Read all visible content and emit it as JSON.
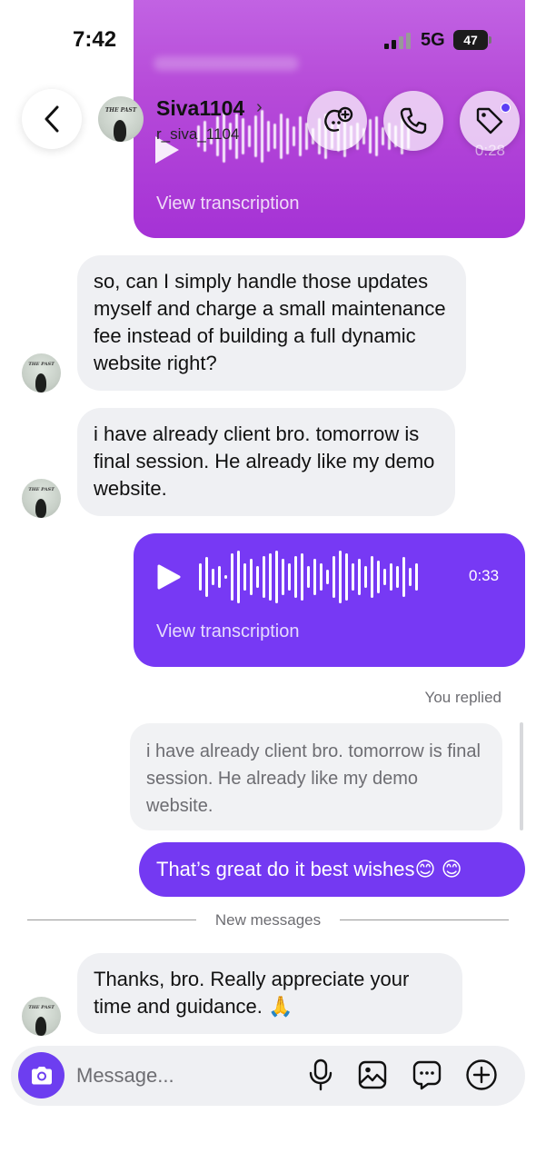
{
  "status_bar": {
    "time": "7:42",
    "network": "5G",
    "battery": "47"
  },
  "header": {
    "contact_name": "Siva1104",
    "contact_handle": "r_siva_1104",
    "name_chevron": "›",
    "avatar_text": "THE PAST"
  },
  "top_voice": {
    "duration": "0:28",
    "transcription_label": "View transcription"
  },
  "messages": {
    "recv_1": "so, can I simply handle those updates myself and charge a small maintenance fee instead of building a full dynamic website right?",
    "recv_2": "i have already client bro. tomorrow is final session. He already like my demo website.",
    "voice": {
      "duration": "0:33",
      "transcription_label": "View transcription"
    },
    "reply_label": "You replied",
    "quoted": "i have already client bro. tomorrow is final session. He already like my demo website.",
    "sent_text": "That’s great do it best wishes😊 😊",
    "new_messages_label": "New messages",
    "recv_3": "Thanks, bro. Really appreciate your time and guidance. 🙏"
  },
  "composer": {
    "placeholder": "Message..."
  },
  "colors": {
    "sent_bubble": "#7439f2",
    "top_voice_bubble": "#b64ad8",
    "received_bubble": "#eff0f3",
    "accent": "#6d3ef0"
  },
  "icons": [
    "back-icon",
    "game-controller-icon",
    "phone-icon",
    "tag-icon",
    "play-icon",
    "camera-icon",
    "microphone-icon",
    "gallery-icon",
    "sticker-message-icon",
    "plus-icon"
  ]
}
